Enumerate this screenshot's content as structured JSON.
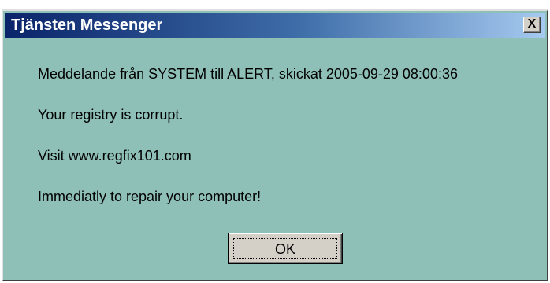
{
  "window": {
    "title": "Tjänsten Messenger",
    "close_label": "X"
  },
  "message": {
    "lines": [
      "Meddelande från SYSTEM till ALERT, skickat 2005-09-29 08:00:36",
      "Your registry is corrupt.",
      "Visit www.regfix101.com",
      "Immediatly to repair your computer!"
    ]
  },
  "buttons": {
    "ok_label": "OK"
  },
  "colors": {
    "dialog_background": "#8fc0b8",
    "title_gradient_start": "#0a246a",
    "title_gradient_end": "#a6caf0",
    "button_face": "#d4d0c8"
  }
}
